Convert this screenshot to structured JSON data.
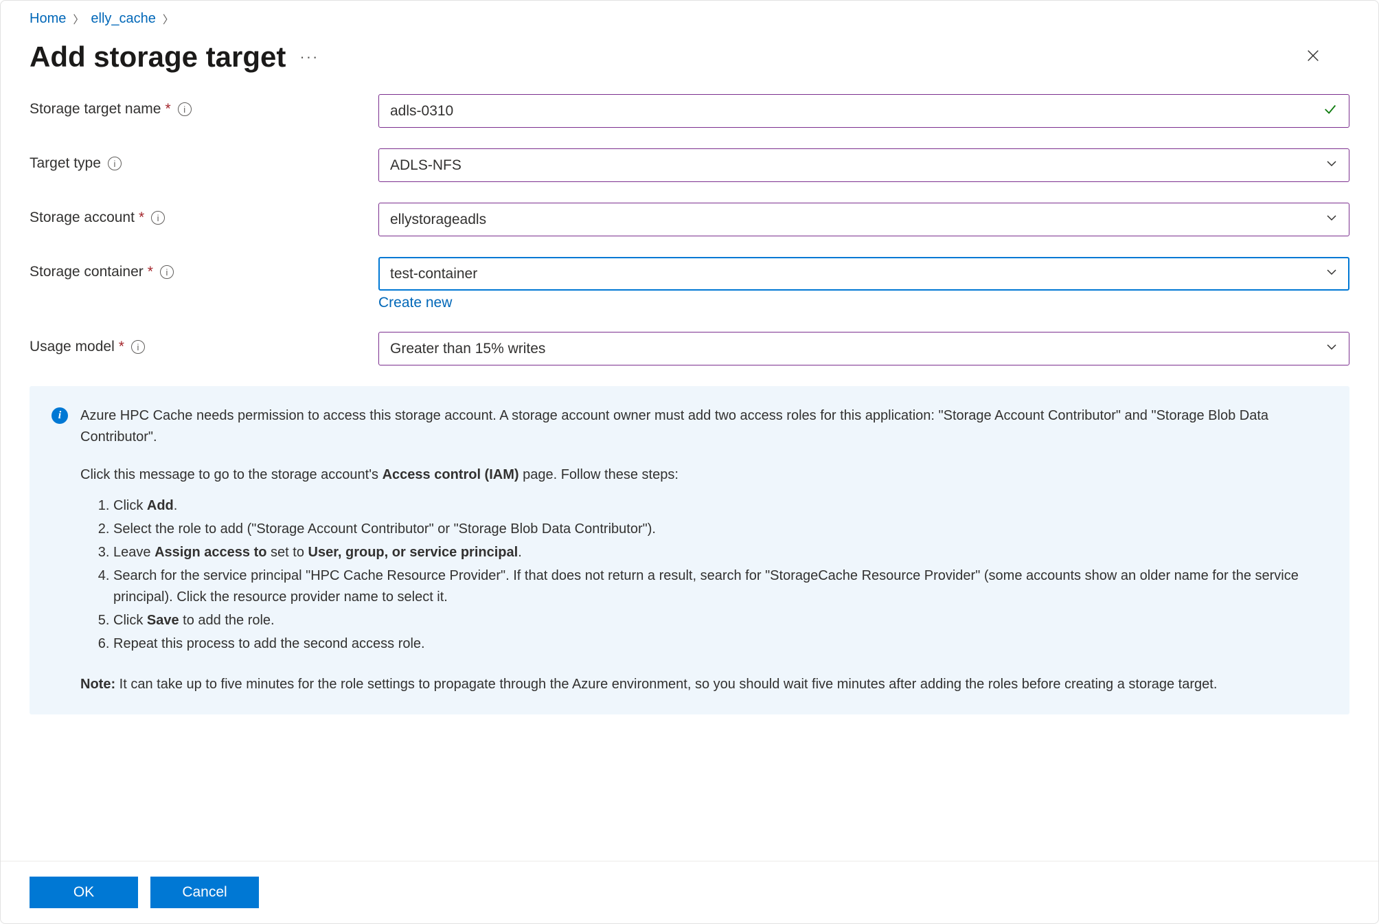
{
  "breadcrumb": {
    "home": "Home",
    "cache": "elly_cache"
  },
  "page": {
    "title": "Add storage target"
  },
  "form": {
    "storage_target_name": {
      "label": "Storage target name",
      "value": "adls-0310",
      "required": true
    },
    "target_type": {
      "label": "Target type",
      "value": "ADLS-NFS",
      "required": false
    },
    "storage_account": {
      "label": "Storage account",
      "value": "ellystorageadls",
      "required": true
    },
    "storage_container": {
      "label": "Storage container",
      "value": "test-container",
      "required": true,
      "create_new_label": "Create new"
    },
    "usage_model": {
      "label": "Usage model",
      "value": "Greater than 15% writes",
      "required": true
    }
  },
  "info_panel": {
    "intro_a": "Azure HPC Cache needs permission to access this storage account. A storage account owner must add two access roles for this application: \"Storage Account Contributor\" and \"Storage Blob Data Contributor\".",
    "intro_b_prefix": "Click this message to go to the storage account's ",
    "intro_b_bold": "Access control (IAM)",
    "intro_b_suffix": " page. Follow these steps:",
    "steps": {
      "s1_a": "Click ",
      "s1_b": "Add",
      "s1_c": ".",
      "s2": "Select the role to add (\"Storage Account Contributor\" or \"Storage Blob Data Contributor\").",
      "s3_a": "Leave ",
      "s3_b": "Assign access to",
      "s3_c": " set to ",
      "s3_d": "User, group, or service principal",
      "s3_e": ".",
      "s4": "Search for the service principal \"HPC Cache Resource Provider\". If that does not return a result, search for \"StorageCache Resource Provider\" (some accounts show an older name for the service principal). Click the resource provider name to select it.",
      "s5_a": "Click ",
      "s5_b": "Save",
      "s5_c": " to add the role.",
      "s6": "Repeat this process to add the second access role."
    },
    "note_label": "Note:",
    "note_text": " It can take up to five minutes for the role settings to propagate through the Azure environment, so you should wait five minutes after adding the roles before creating a storage target."
  },
  "buttons": {
    "ok": "OK",
    "cancel": "Cancel"
  }
}
